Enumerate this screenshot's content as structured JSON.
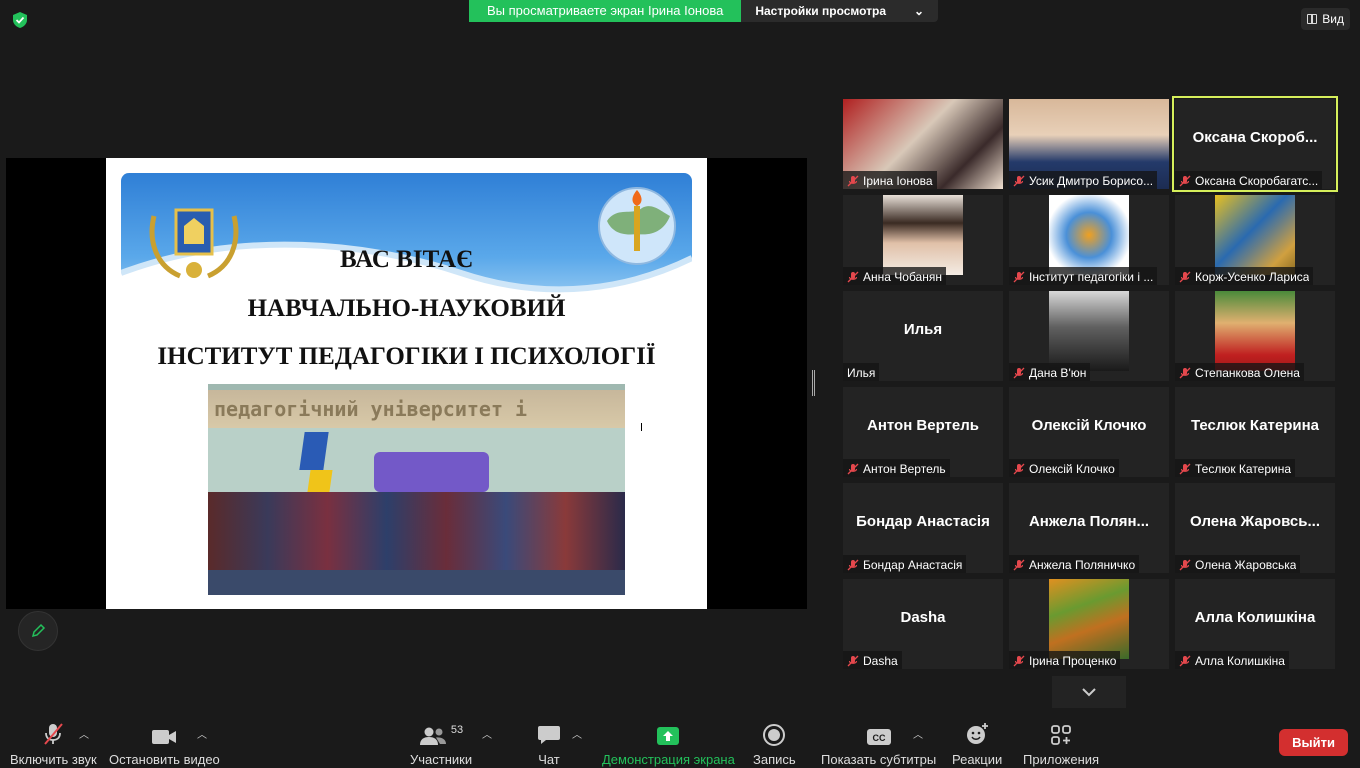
{
  "top": {
    "share_notice": "Вы просматриваете экран Ірина Іонова",
    "view_options": "Настройки просмотра",
    "view_button": "Вид"
  },
  "slide": {
    "line1": "ВАС ВІТАЄ",
    "line2": "НАВЧАЛЬНО-НАУКОВИЙ",
    "line3": "ІНСТИТУТ ПЕДАГОГІКИ І ПСИХОЛОГІЇ",
    "photo_banner": "педагогічний університет і"
  },
  "participants": [
    {
      "name": "Ірина Іонова",
      "big": "",
      "muted": true,
      "video": true
    },
    {
      "name": "Усик Дмитро Борисо...",
      "big": "",
      "muted": true,
      "video": true
    },
    {
      "name": "Оксана Скоробагатс...",
      "big": "Оксана  Скороб...",
      "muted": true,
      "video": false,
      "active": true
    },
    {
      "name": "Анна Чобанян",
      "big": "",
      "muted": true,
      "video": true
    },
    {
      "name": "Інститут педагогіки і ...",
      "big": "",
      "muted": true,
      "video": true
    },
    {
      "name": "Корж-Усенко Лариса",
      "big": "",
      "muted": true,
      "video": true
    },
    {
      "name": "Илья",
      "big": "Илья",
      "muted": false,
      "video": false
    },
    {
      "name": "Дана В'юн",
      "big": "",
      "muted": true,
      "video": true
    },
    {
      "name": "Степанкова Олена",
      "big": "",
      "muted": true,
      "video": true
    },
    {
      "name": "Антон Вертель",
      "big": "Антон Вертель",
      "muted": true,
      "video": false
    },
    {
      "name": "Олексій Клочко",
      "big": "Олексій Клочко",
      "muted": true,
      "video": false
    },
    {
      "name": "Теслюк Катерина",
      "big": "Теслюк Катерина",
      "muted": true,
      "video": false
    },
    {
      "name": "Бондар Анастасія",
      "big": "Бондар Анастасія",
      "muted": true,
      "video": false
    },
    {
      "name": "Анжела Поляничко",
      "big": "Анжела  Полян...",
      "muted": true,
      "video": false
    },
    {
      "name": "Олена Жаровська",
      "big": "Олена  Жаровсь...",
      "muted": true,
      "video": false
    },
    {
      "name": "Dasha",
      "big": "Dasha",
      "muted": true,
      "video": false
    },
    {
      "name": "Ірина Проценко",
      "big": "",
      "muted": true,
      "video": true
    },
    {
      "name": "Алла Колишкіна",
      "big": "Алла Колишкіна",
      "muted": true,
      "video": false
    }
  ],
  "toolbar": {
    "unmute": "Включить звук",
    "stop_video": "Остановить видео",
    "participants": "Участники",
    "participants_count": "53",
    "chat": "Чат",
    "share": "Демонстрация экрана",
    "record": "Запись",
    "captions": "Показать субтитры",
    "reactions": "Реакции",
    "apps": "Приложения",
    "leave": "Выйти"
  },
  "colors": {
    "green": "#23c15b",
    "active_speaker": "#d6ef5b",
    "leave_red": "#d32f2f",
    "mute_red": "#e5484d"
  }
}
